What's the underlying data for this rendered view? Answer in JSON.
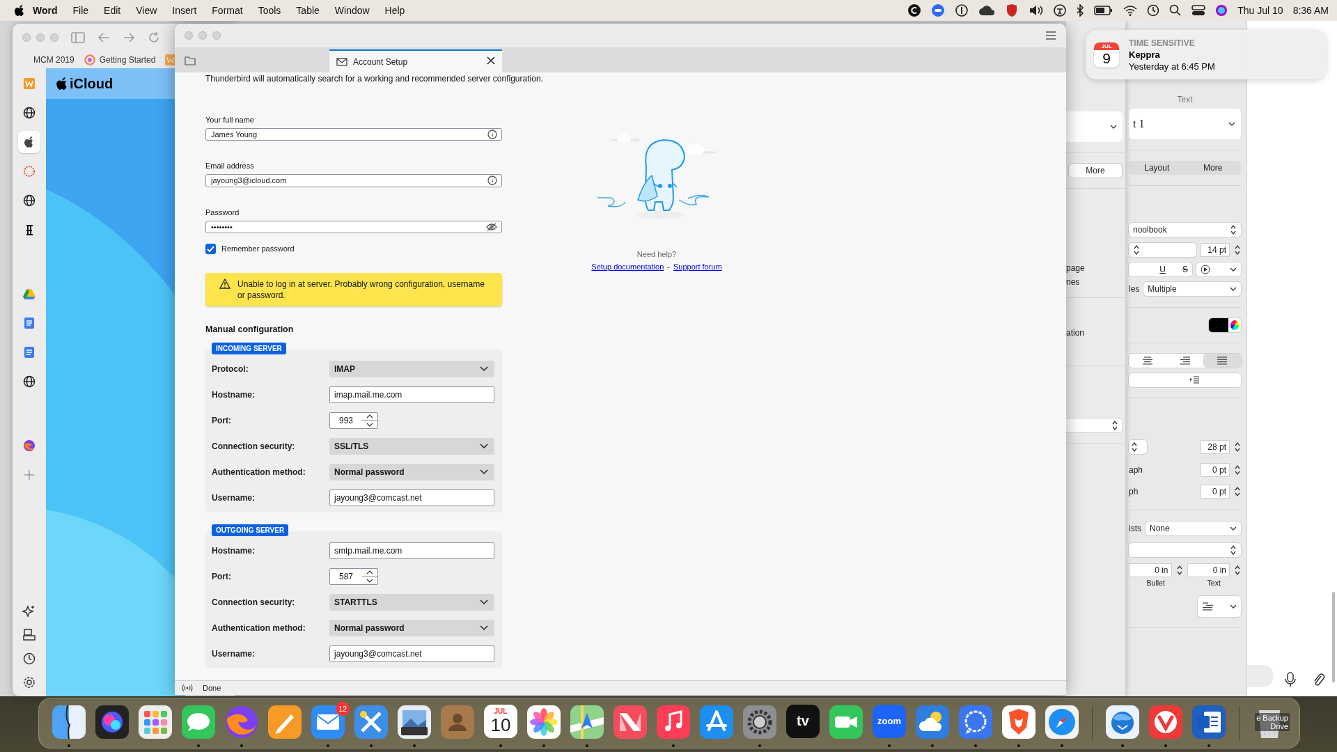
{
  "menubar": {
    "app": "Word",
    "menus": [
      "File",
      "Edit",
      "View",
      "Insert",
      "Format",
      "Tools",
      "Table",
      "Window",
      "Help"
    ],
    "date": "Thu Jul 10",
    "time": "8:36 AM"
  },
  "browser": {
    "tabs": [
      {
        "label": "MCM 2019"
      },
      {
        "label": "Getting Started"
      }
    ],
    "sidebar": [
      {
        "kind": "office",
        "selected": false
      },
      {
        "kind": "globe",
        "selected": false
      },
      {
        "kind": "apple",
        "selected": true
      },
      {
        "kind": "ring",
        "selected": false
      },
      {
        "kind": "globe",
        "selected": false
      },
      {
        "kind": "newspaper",
        "selected": false
      },
      {
        "kind": "drive",
        "selected": false
      },
      {
        "kind": "docs",
        "selected": false
      },
      {
        "kind": "docs",
        "selected": false
      },
      {
        "kind": "globe",
        "selected": false
      },
      {
        "kind": "fox",
        "selected": false
      },
      {
        "kind": "add",
        "selected": false
      }
    ],
    "sidebar_tools": [
      {
        "kind": "sparkle"
      },
      {
        "kind": "disk"
      },
      {
        "kind": "history"
      },
      {
        "kind": "settings"
      }
    ],
    "site_title": "iCloud"
  },
  "mail_window": {
    "tab": {
      "title": "Account Setup"
    },
    "intro": "Thunderbird will automatically search for a working and recommended server configuration.",
    "fields": [
      {
        "label": "Your full name",
        "value": "James Young",
        "kind": "info"
      },
      {
        "label": "Email address",
        "value": "jayoung3@icloud.com",
        "kind": "info"
      },
      {
        "label": "Password",
        "value": "••••••••",
        "kind": "password"
      }
    ],
    "remember": {
      "label": "Remember password",
      "checked": true
    },
    "warning": "Unable to log in at server. Probably wrong configuration, username or password.",
    "manual_title": "Manual configuration",
    "servers": [
      {
        "badge": "INCOMING SERVER",
        "rows": [
          {
            "label": "Protocol:",
            "kind": "select",
            "value": "IMAP"
          },
          {
            "label": "Hostname:",
            "kind": "text",
            "value": "imap.mail.me.com"
          },
          {
            "label": "Port:",
            "kind": "port",
            "value": "993"
          },
          {
            "label": "Connection security:",
            "kind": "select",
            "value": "SSL/TLS"
          },
          {
            "label": "Authentication method:",
            "kind": "select",
            "value": "Normal password"
          },
          {
            "label": "Username:",
            "kind": "text",
            "value": "jayoung3@comcast.net"
          }
        ]
      },
      {
        "badge": "OUTGOING SERVER",
        "rows": [
          {
            "label": "Hostname:",
            "kind": "text",
            "value": "smtp.mail.me.com"
          },
          {
            "label": "Port:",
            "kind": "port",
            "value": "587"
          },
          {
            "label": "Connection security:",
            "kind": "select",
            "value": "STARTTLS"
          },
          {
            "label": "Authentication method:",
            "kind": "select",
            "value": "Normal password"
          },
          {
            "label": "Username:",
            "kind": "text",
            "value": "jayoung3@comcast.net"
          }
        ]
      }
    ],
    "help": {
      "title": "Need help?",
      "links": [
        "Setup documentation",
        "Support forum"
      ],
      "separator": "-"
    },
    "status": "Done"
  },
  "notification": {
    "month": "JUL",
    "day": "9",
    "tag": "TIME SENSITIVE",
    "title": "Keppra",
    "time": "Yesterday at 6:45 PM"
  },
  "word": {
    "left": {
      "more": {
        "label": "More",
        "selected": true
      },
      "texts": [
        "page",
        "nes",
        "ation"
      ]
    },
    "right": {
      "header": "Text",
      "style": "t 1",
      "tabs": [
        {
          "label": "Layout",
          "selected": false
        },
        {
          "label": "More",
          "selected": false
        }
      ],
      "font": "noolbook",
      "size": "14 pt",
      "underline": "U",
      "strike": "S",
      "styles_label": "les",
      "styles_value": "Multiple",
      "alignment": [
        {
          "selected": false
        },
        {
          "selected": false
        },
        {
          "selected": true
        }
      ],
      "line_value": "28 pt",
      "before": {
        "label": "aph",
        "value": "0 pt"
      },
      "after": {
        "label": "ph",
        "value": "0 pt"
      },
      "lists": {
        "label": "ists",
        "value": "None"
      },
      "indents": [
        {
          "value": "0 in",
          "caption": "Bullet"
        },
        {
          "value": "0 in",
          "caption": "Text"
        }
      ]
    }
  },
  "dock": {
    "items": [
      {
        "kind": "finder",
        "running": true
      },
      {
        "kind": "siri",
        "running": false
      },
      {
        "kind": "launchpad",
        "running": false
      },
      {
        "kind": "messages",
        "running": true
      },
      {
        "kind": "firefox",
        "running": true
      },
      {
        "kind": "pages",
        "running": false
      },
      {
        "kind": "mail",
        "running": true,
        "badge": "12"
      },
      {
        "kind": "tools",
        "running": true
      },
      {
        "kind": "preview",
        "running": true
      },
      {
        "kind": "contacts",
        "running": false
      },
      {
        "kind": "calendar",
        "running": true,
        "month": "JUL",
        "day": "10"
      },
      {
        "kind": "photos",
        "running": true
      },
      {
        "kind": "maps",
        "running": true
      },
      {
        "kind": "news",
        "running": false
      },
      {
        "kind": "music",
        "running": true
      },
      {
        "kind": "store",
        "running": false
      },
      {
        "kind": "settings",
        "running": true
      },
      {
        "kind": "tv",
        "running": false,
        "label": "tv"
      },
      {
        "kind": "facetime",
        "running": false
      },
      {
        "kind": "zoom",
        "running": true,
        "label": "zoom"
      },
      {
        "kind": "weather",
        "running": true
      },
      {
        "kind": "signal",
        "running": true
      },
      {
        "kind": "brave",
        "running": true
      },
      {
        "kind": "safari",
        "running": true
      },
      {
        "kind": "separator"
      },
      {
        "kind": "thunderbird",
        "running": true
      },
      {
        "kind": "vivaldi",
        "running": true
      },
      {
        "kind": "word",
        "running": true
      },
      {
        "kind": "separator"
      },
      {
        "kind": "trash",
        "running": false
      }
    ],
    "drive_label": [
      "e Backup",
      "Drive"
    ]
  }
}
